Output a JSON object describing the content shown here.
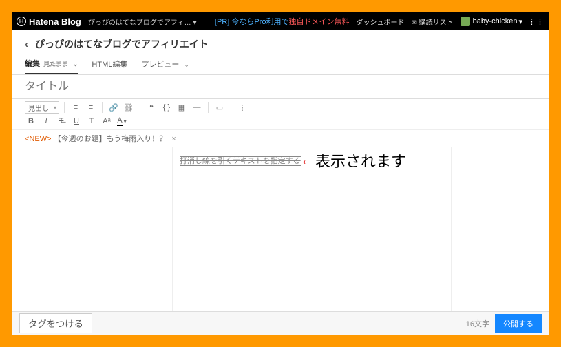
{
  "topbar": {
    "brand": "Hatena Blog",
    "blogname": "ぴっぴのはてなブログでアフィ…",
    "blogname_caret": "▾",
    "promo_prefix": "[PR] ",
    "promo_text": "今ならPro利用で",
    "promo_emph": "独自ドメイン無料",
    "dashboard": "ダッシュボード",
    "deliver_list": "購読リスト",
    "username": "baby-chicken",
    "user_caret": "▾",
    "menu_glyph": "⋮⋮"
  },
  "header": {
    "back": "‹",
    "title": "ぴっぴのはてなブログでアフィリエイト"
  },
  "tabs": {
    "edit_label": "編集",
    "edit_sub": "見たまま",
    "html_label": "HTML編集",
    "preview_label": "プレビュー"
  },
  "title_placeholder": "タイトル",
  "toolbar": {
    "heading_sel": "見出し",
    "ul": "≡",
    "ol": "≡",
    "link": "🔗",
    "unlink": "⛓",
    "quote": "❝",
    "code": "{ }",
    "table": "▦",
    "hr": "—",
    "image": "▭",
    "more": "⋮",
    "bold": "B",
    "italic": "I",
    "strike": "T̶",
    "underline": "U",
    "tt": "T",
    "super": "Aᵃ",
    "color": "A",
    "color_caret": "▾"
  },
  "notice": {
    "new": "<NEW>",
    "text": "【今週のお題】もう梅雨入り！？",
    "close": "×"
  },
  "editor": {
    "strike_text": "打消し線を引くテキストを指定する"
  },
  "annotation": {
    "arrow": "←",
    "text": "表示されます"
  },
  "footer": {
    "tag_btn": "タグをつける",
    "char_count": "16文字",
    "publish": "公開する"
  }
}
